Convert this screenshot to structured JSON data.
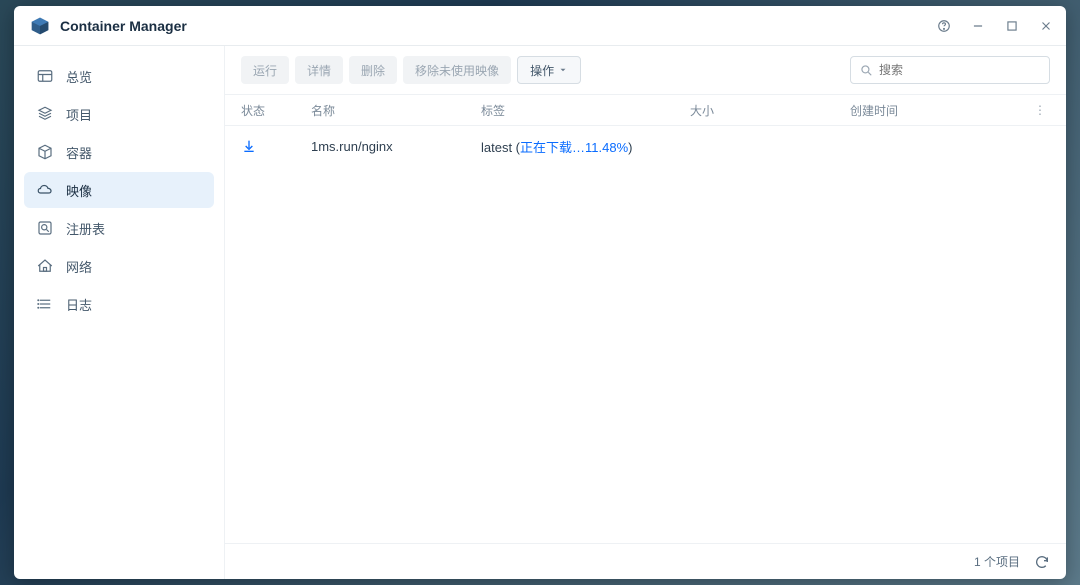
{
  "window": {
    "title": "Container Manager"
  },
  "sidebar": {
    "items": [
      {
        "key": "overview",
        "label": "总览"
      },
      {
        "key": "project",
        "label": "项目"
      },
      {
        "key": "container",
        "label": "容器"
      },
      {
        "key": "image",
        "label": "映像"
      },
      {
        "key": "registry",
        "label": "注册表"
      },
      {
        "key": "network",
        "label": "网络"
      },
      {
        "key": "log",
        "label": "日志"
      }
    ],
    "active": "image"
  },
  "toolbar": {
    "run": "运行",
    "details": "详情",
    "delete": "删除",
    "removeUnused": "移除未使用映像",
    "actions": "操作",
    "search_placeholder": "搜索"
  },
  "table": {
    "headers": {
      "status": "状态",
      "name": "名称",
      "tag": "标签",
      "size": "大小",
      "created": "创建时间"
    },
    "rows": [
      {
        "status": "downloading",
        "name": "1ms.run/nginx",
        "tag_prefix": "latest (",
        "tag_status": "正在下载…11.48%",
        "tag_suffix": ")",
        "size": "",
        "created": ""
      }
    ]
  },
  "footer": {
    "count_label": "1 个项目"
  }
}
